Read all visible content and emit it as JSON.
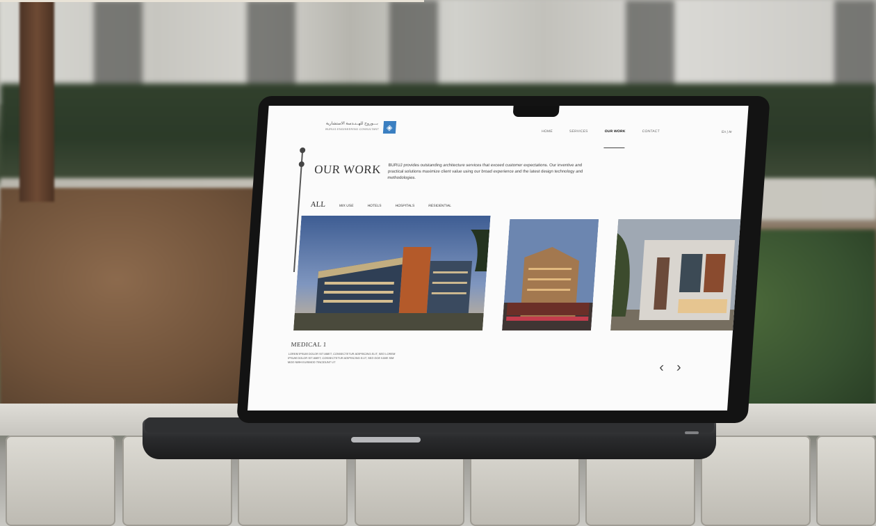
{
  "website": {
    "logo": {
      "arabic_text": "بـــوروج للهــنـدسة الاستشارية",
      "english_text": "BURUG ENGINEERING CONSULTANT"
    },
    "nav": [
      {
        "label": "HOME"
      },
      {
        "label": "SERVICES"
      },
      {
        "label": "OUR WORK",
        "active": true
      },
      {
        "label": "CONTACT"
      }
    ],
    "lang_switch": "En | Ar",
    "section_title": "OUR WORK",
    "description": "BURUJ provides outstanding architecture services that exceed customer expectations. Our inventive and practical solutions maximize client value using our broad experience and the latest design technology and methodologies.",
    "filters": [
      {
        "label": "ALL",
        "active": true
      },
      {
        "label": "MIX USE"
      },
      {
        "label": "HOTELS"
      },
      {
        "label": "HOSPITALS"
      },
      {
        "label": "RESIDENTIAL"
      }
    ],
    "projects": [
      {
        "name": "MEDICAL 1"
      },
      {
        "name": ""
      },
      {
        "name": ""
      }
    ],
    "caption": {
      "title": "MEDICAL 1",
      "text": "LOREM IPSUM DOLOR SIT AMET, CONSECTETUR ADIPISCING ELIT, SED LOREM IPSUM DOLOR SIT AMET, CONSECTETUR ADIPISCING ELIT, SED DOE IUME SIM MOD NIBH EUISMOD TINCIDUNT UT"
    },
    "arrows": {
      "prev": "‹",
      "next": "›"
    }
  },
  "colors": {
    "accent_blue": "#3a7fc1",
    "page_bg": "#fbfbfb",
    "text_dark": "#333333"
  },
  "icons": [
    "logo-mark-icon",
    "chevron-left-icon",
    "chevron-right-icon"
  ]
}
